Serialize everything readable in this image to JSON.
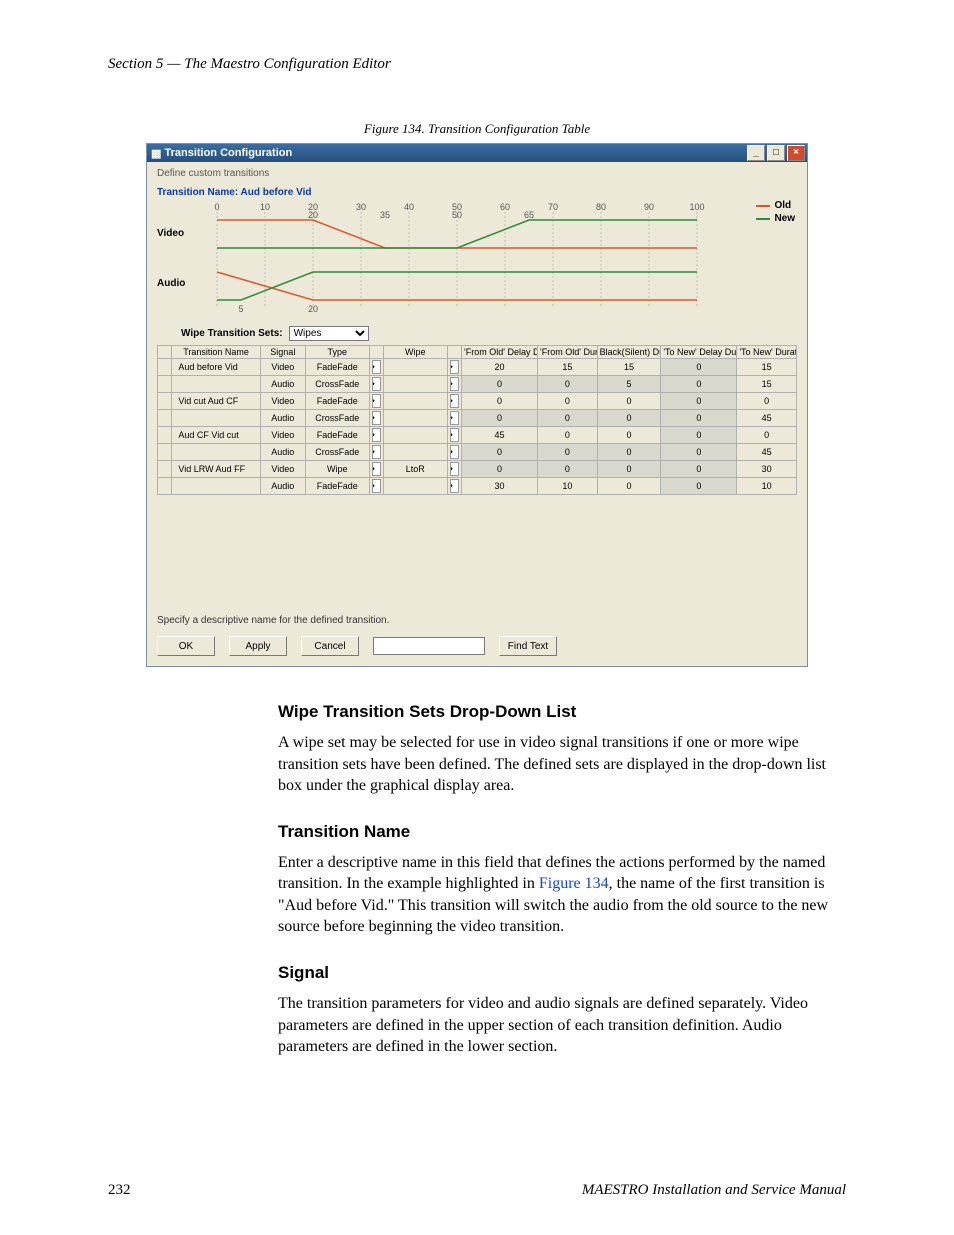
{
  "header": {
    "section_line": "Section 5 — The Maestro Configuration Editor"
  },
  "figure": {
    "caption": "Figure 134.  Transition Configuration Table",
    "window_title": "Transition Configuration",
    "hint": "Define custom transitions",
    "tn_label": "Transition Name:   Aud before Vid",
    "legend_old": "Old",
    "legend_new": "New",
    "video_label": "Video",
    "audio_label": "Audio",
    "wts_label": "Wipe Transition Sets:",
    "wts_value": "Wipes",
    "columns": [
      "",
      "Transition Name",
      "Signal",
      "Type",
      "",
      "Wipe",
      "",
      "'From Old' Delay Duration",
      "'From Old' Duration",
      "Black(Silent) Duration",
      "'To New' Delay Duration",
      "'To New' Duration"
    ],
    "rows": [
      {
        "name": "Aud before Vid",
        "signal": "Video",
        "type": "FadeFade",
        "wipe": "",
        "c1": "20",
        "c2": "15",
        "c3": "15",
        "c4": "0",
        "c5": "15",
        "shade4": true
      },
      {
        "name": "",
        "signal": "Audio",
        "type": "CrossFade",
        "wipe": "",
        "c1": "0",
        "c2": "0",
        "c3": "5",
        "c4": "0",
        "c5": "15",
        "shade1": true,
        "shade2": true,
        "shade3": true,
        "shade4": true
      },
      {
        "name": "Vid cut Aud CF",
        "signal": "Video",
        "type": "FadeFade",
        "wipe": "",
        "c1": "0",
        "c2": "0",
        "c3": "0",
        "c4": "0",
        "c5": "0",
        "shade4": true
      },
      {
        "name": "",
        "signal": "Audio",
        "type": "CrossFade",
        "wipe": "",
        "c1": "0",
        "c2": "0",
        "c3": "0",
        "c4": "0",
        "c5": "45",
        "shade1": true,
        "shade2": true,
        "shade3": true,
        "shade4": true
      },
      {
        "name": "Aud CF Vid cut",
        "signal": "Video",
        "type": "FadeFade",
        "wipe": "",
        "c1": "45",
        "c2": "0",
        "c3": "0",
        "c4": "0",
        "c5": "0",
        "shade4": true
      },
      {
        "name": "",
        "signal": "Audio",
        "type": "CrossFade",
        "wipe": "",
        "c1": "0",
        "c2": "0",
        "c3": "0",
        "c4": "0",
        "c5": "45",
        "shade1": true,
        "shade2": true,
        "shade3": true,
        "shade4": true
      },
      {
        "name": "Vid LRW Aud FF",
        "signal": "Video",
        "type": "Wipe",
        "wipe": "LtoR",
        "c1": "0",
        "c2": "0",
        "c3": "0",
        "c4": "0",
        "c5": "30",
        "shade1": true,
        "shade2": true,
        "shade3": true,
        "shade4": true
      },
      {
        "name": "",
        "signal": "Audio",
        "type": "FadeFade",
        "wipe": "",
        "c1": "30",
        "c2": "10",
        "c3": "0",
        "c4": "0",
        "c5": "10",
        "shade4": true
      }
    ],
    "desc_line": "Specify a descriptive name for the defined transition.",
    "btn_ok": "OK",
    "btn_apply": "Apply",
    "btn_cancel": "Cancel",
    "btn_find": "Find Text"
  },
  "chart_data": [
    {
      "type": "line",
      "title": "Video",
      "xlim": [
        0,
        100
      ],
      "ticks_top": [
        0,
        10,
        20,
        30,
        40,
        50,
        60,
        70,
        80,
        90,
        100
      ],
      "annotations_bottom": {
        "20": 20,
        "35": 35,
        "50": 50,
        "65": 65
      },
      "series": [
        {
          "name": "Old",
          "color": "#d65a2b",
          "points": [
            [
              0,
              1
            ],
            [
              20,
              1
            ],
            [
              35,
              0
            ],
            [
              100,
              0
            ]
          ]
        },
        {
          "name": "New",
          "color": "#2f8a3a",
          "points": [
            [
              0,
              0
            ],
            [
              50,
              0
            ],
            [
              65,
              1
            ],
            [
              100,
              1
            ]
          ]
        }
      ]
    },
    {
      "type": "line",
      "title": "Audio",
      "xlim": [
        0,
        100
      ],
      "annotations_bottom": {
        "5": 5,
        "20": 20
      },
      "series": [
        {
          "name": "Old",
          "color": "#d65a2b",
          "points": [
            [
              0,
              1
            ],
            [
              20,
              0
            ],
            [
              100,
              0
            ]
          ]
        },
        {
          "name": "New",
          "color": "#2f8a3a",
          "points": [
            [
              0,
              0
            ],
            [
              5,
              0
            ],
            [
              20,
              1
            ],
            [
              100,
              1
            ]
          ]
        }
      ]
    }
  ],
  "body": {
    "h1": "Wipe Transition Sets Drop-Down List",
    "p1": "A wipe set may be selected for use in video signal transitions if one or more wipe transition sets have been defined. The defined sets are displayed in the drop-down list box under the graphical display area.",
    "h2": "Transition Name",
    "p2a": "Enter a descriptive name in this field that defines the actions performed by the named transition. In the example highlighted in ",
    "p2link": "Figure 134",
    "p2b": ", the name of the first transition is \"Aud before Vid.\" This transition will switch the audio from the old source to the new source before beginning the video transition.",
    "h3": "Signal",
    "p3": "The transition parameters for video and audio signals are defined separately. Video parameters are defined in the upper section of each transition definition. Audio parameters are defined in the lower section."
  },
  "footer": {
    "page": "232",
    "manual": "MAESTRO Installation and Service Manual"
  }
}
